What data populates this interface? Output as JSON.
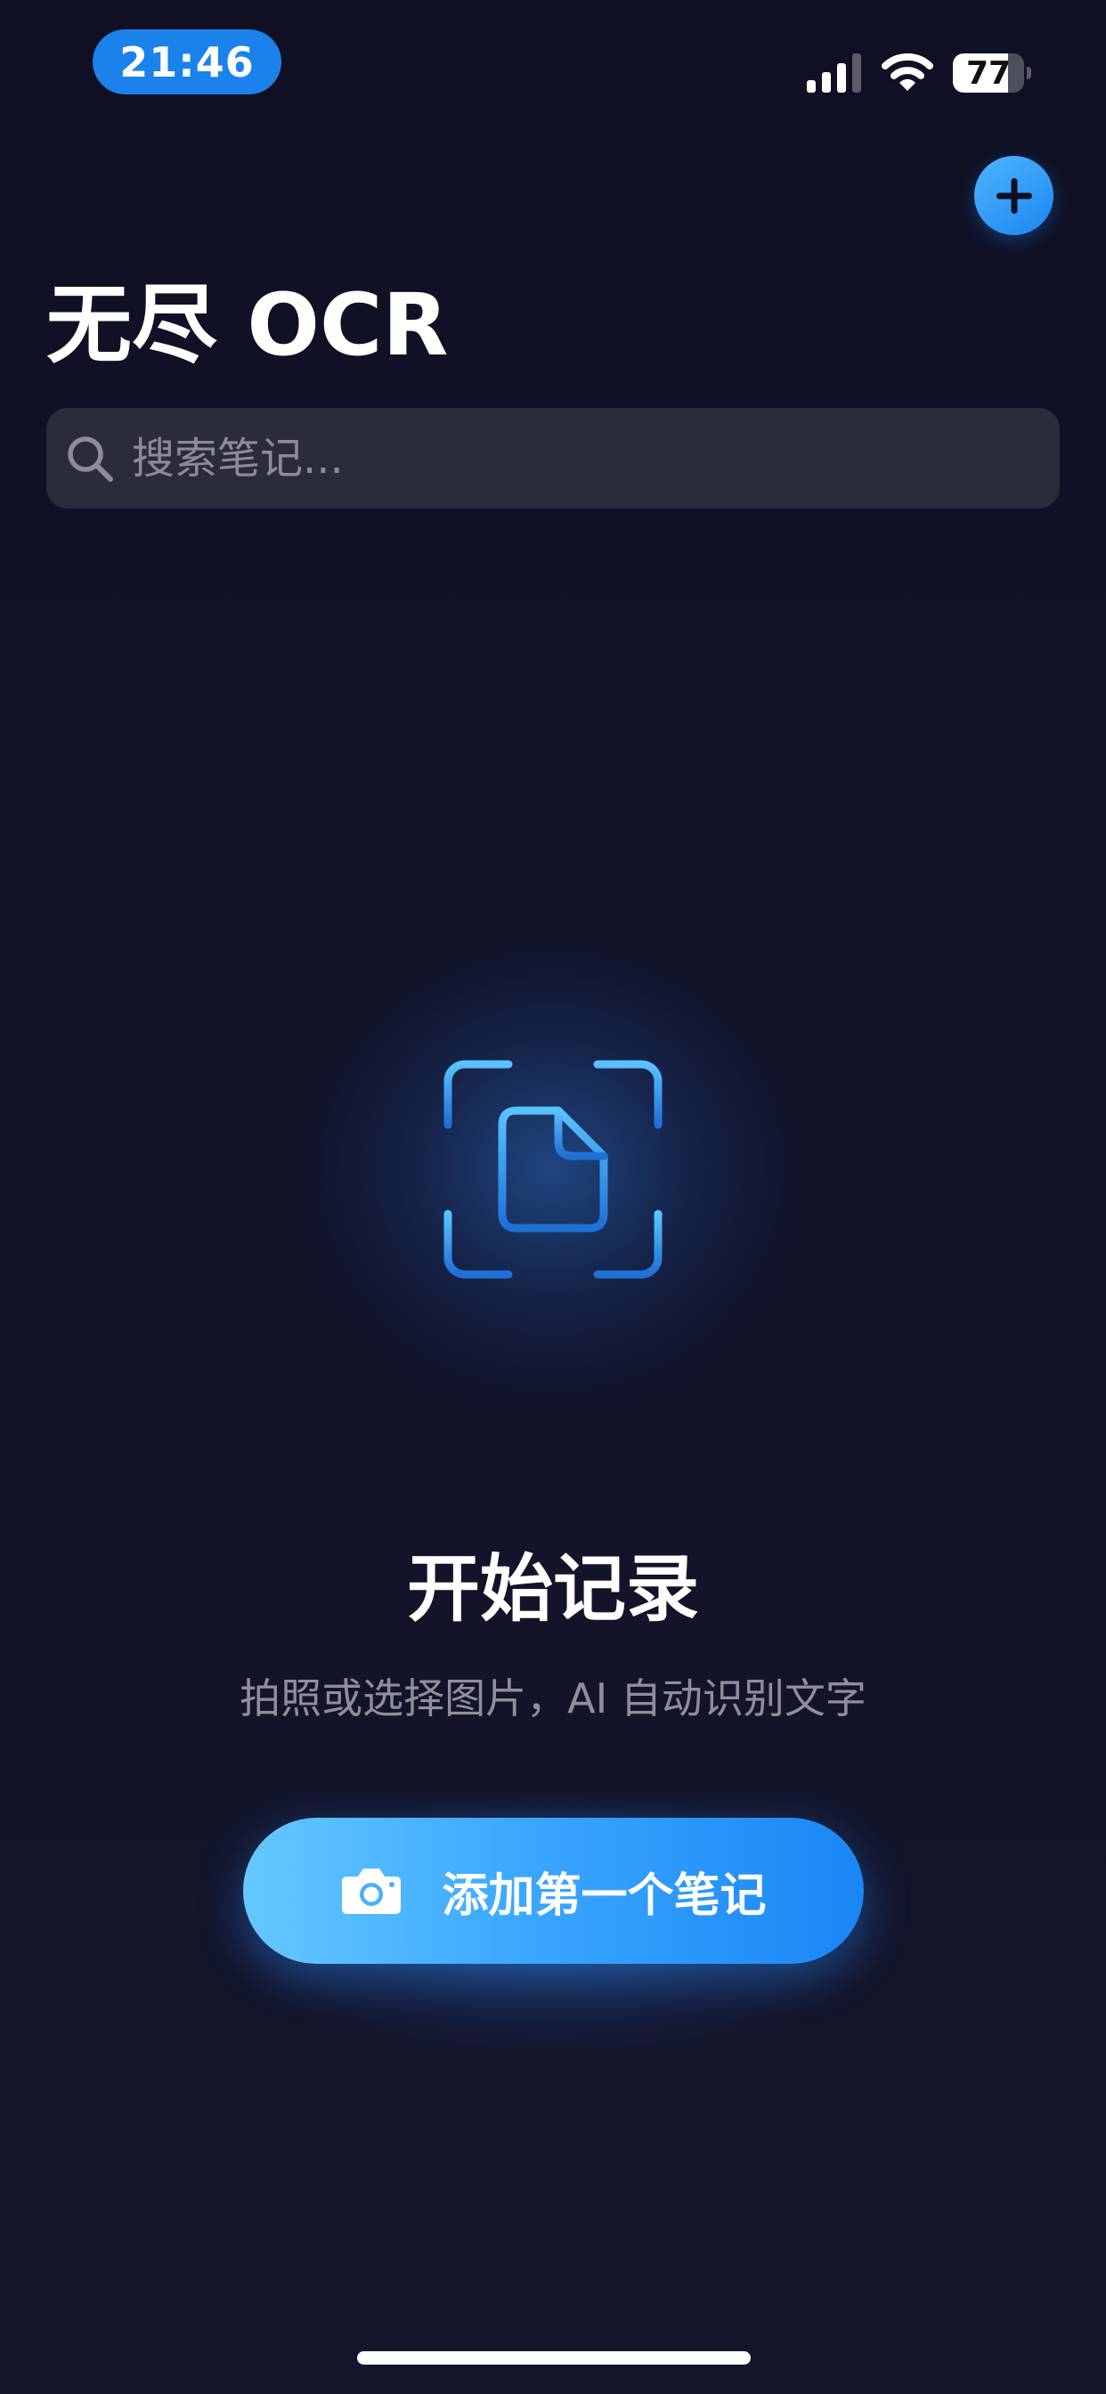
{
  "status_bar": {
    "time": "21:46",
    "battery_level": "77",
    "battery_fraction": 0.77,
    "signal_icon": "cellular-signal-icon",
    "wifi_icon": "wifi-icon"
  },
  "header": {
    "title": "无尽 OCR",
    "add_icon": "plus-icon"
  },
  "search": {
    "placeholder": "搜索笔记...",
    "value": "",
    "icon": "search-icon"
  },
  "empty_state": {
    "icon": "document-scan-icon",
    "title": "开始记录",
    "subtitle": "拍照或选择图片，AI 自动识别文字",
    "cta_label": "添加第一个笔记",
    "cta_icon": "camera-icon"
  },
  "colors": {
    "background": "#12132a",
    "accent": "#1a86f5",
    "accent_light": "#66c8ff",
    "search_bg": "#2a2b3b",
    "muted_text": "#8e8f9b"
  }
}
